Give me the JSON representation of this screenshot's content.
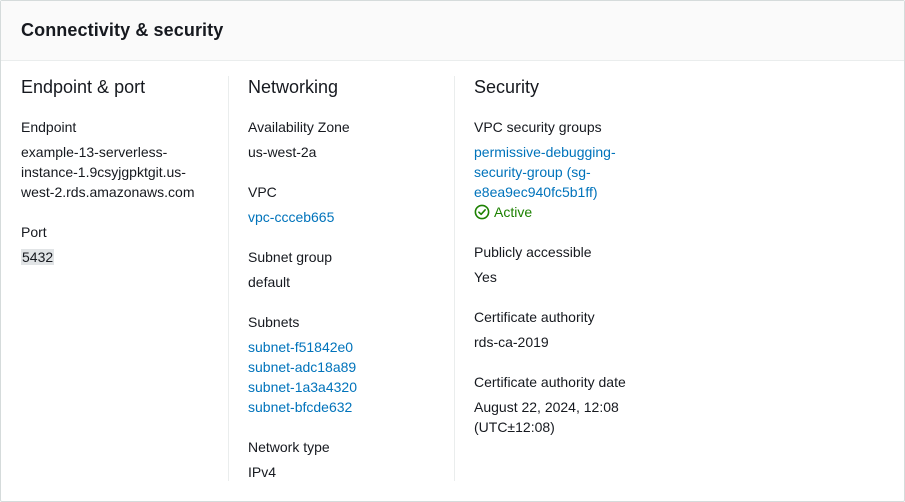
{
  "panel": {
    "title": "Connectivity & security"
  },
  "endpoint_port": {
    "heading": "Endpoint & port",
    "endpoint_label": "Endpoint",
    "endpoint_lines": [
      "example-13-serverless-",
      "instance-1.9csyjgpktgit.us-",
      "west-2.rds.amazonaws.com"
    ],
    "port_label": "Port",
    "port_value": "5432"
  },
  "networking": {
    "heading": "Networking",
    "az_label": "Availability Zone",
    "az_value": "us-west-2a",
    "vpc_label": "VPC",
    "vpc_value": "vpc-ccceb665",
    "subnet_group_label": "Subnet group",
    "subnet_group_value": "default",
    "subnets_label": "Subnets",
    "subnets": [
      "subnet-f51842e0",
      "subnet-adc18a89",
      "subnet-1a3a4320",
      "subnet-bfcde632"
    ],
    "network_type_label": "Network type",
    "network_type_value": "IPv4"
  },
  "security": {
    "heading": "Security",
    "sg_label": "VPC security groups",
    "sg_lines": [
      "permissive-debugging-",
      "security-group (sg-",
      "e8ea9ec940fc5b1ff)"
    ],
    "sg_status": "Active",
    "status_color": "#1d8102",
    "public_label": "Publicly accessible",
    "public_value": "Yes",
    "ca_label": "Certificate authority",
    "ca_value": "rds-ca-2019",
    "ca_date_label": "Certificate authority date",
    "ca_date_lines": [
      "August 22, 2024, 12:08",
      "(UTC±12:08)"
    ]
  },
  "colors": {
    "link": "#0073bb",
    "text": "#16191f",
    "border": "#d5dbdb"
  }
}
